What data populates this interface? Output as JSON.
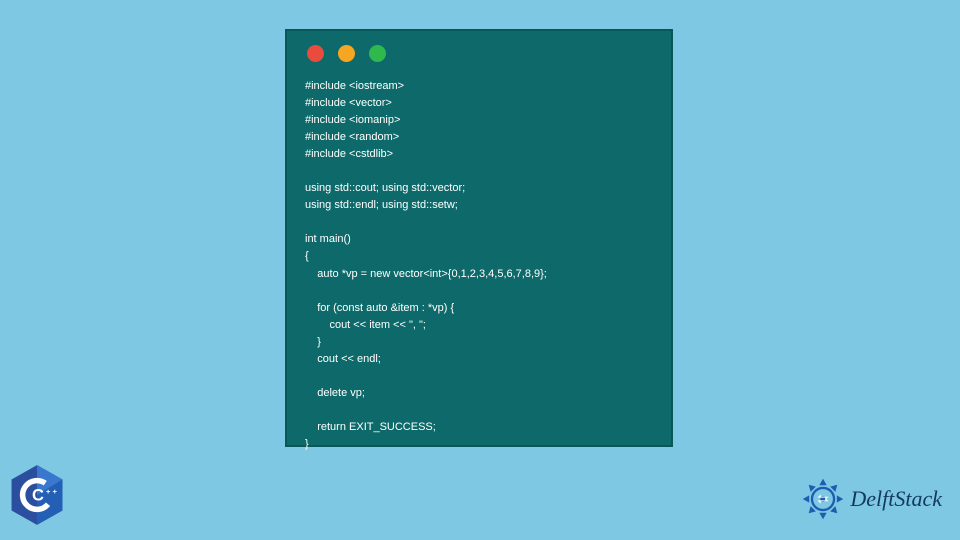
{
  "window": {
    "traffic_lights": {
      "red": "#e94b3c",
      "yellow": "#f5a623",
      "green": "#2fb84c"
    }
  },
  "code": {
    "lines": [
      "#include <iostream>",
      "#include <vector>",
      "#include <iomanip>",
      "#include <random>",
      "#include <cstdlib>",
      "",
      "using std::cout; using std::vector;",
      "using std::endl; using std::setw;",
      "",
      "int main()",
      "{",
      "    auto *vp = new vector<int>{0,1,2,3,4,5,6,7,8,9};",
      "",
      "    for (const auto &item : *vp) {",
      "        cout << item << \", \";",
      "    }",
      "    cout << endl;",
      "",
      "    delete vp;",
      "",
      "    return EXIT_SUCCESS;",
      "}"
    ]
  },
  "badges": {
    "cpp_label": "C++",
    "brand_name": "DelftStack"
  },
  "colors": {
    "page_bg": "#7ec8e3",
    "window_bg": "#0e6a6a",
    "code_text": "#ffffff",
    "brand_text": "#123a5c",
    "brand_icon": "#1e5db0",
    "cpp_blue": "#2b4f9e"
  }
}
